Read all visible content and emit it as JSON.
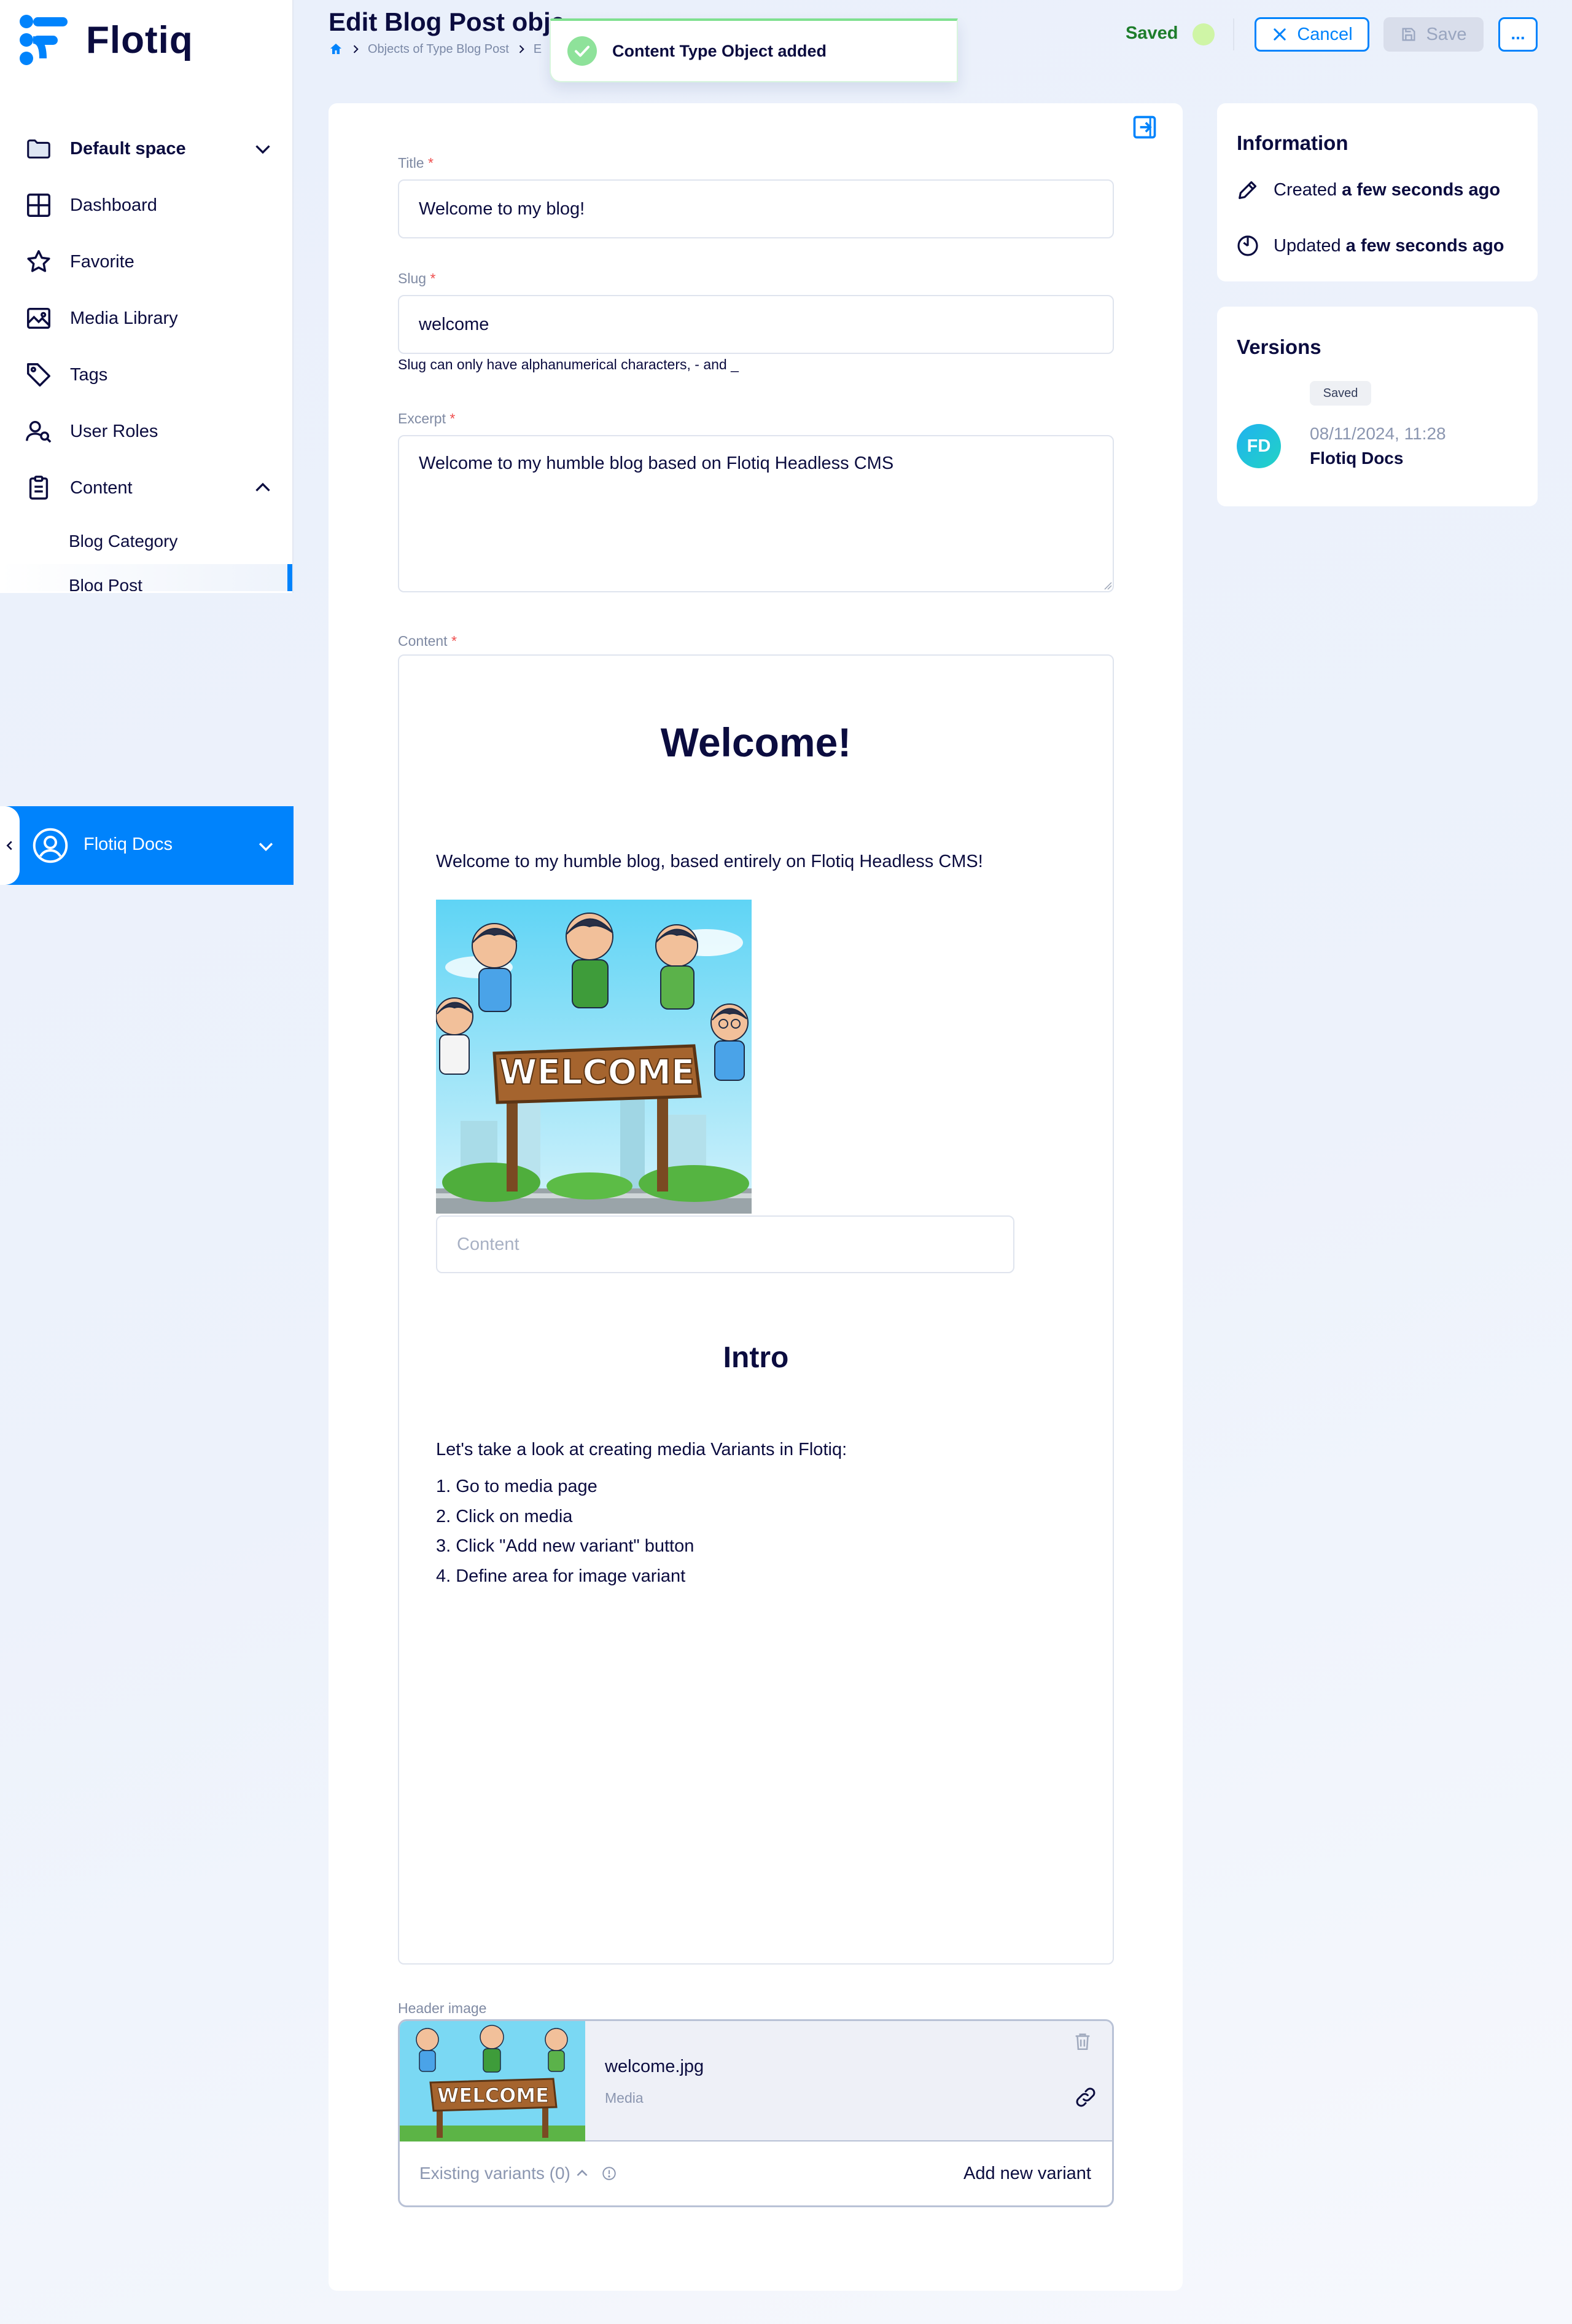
{
  "brand": {
    "name": "Flotiq",
    "accent": "#0083fc",
    "text": "#0b0c3f"
  },
  "sidebar": {
    "space": {
      "label": "Default space",
      "icon": "folder-icon"
    },
    "items": [
      {
        "label": "Dashboard",
        "icon": "grid-icon"
      },
      {
        "label": "Favorite",
        "icon": "star-icon"
      },
      {
        "label": "Media Library",
        "icon": "image-icon"
      },
      {
        "label": "Tags",
        "icon": "tag-icon"
      },
      {
        "label": "User Roles",
        "icon": "user-roles-icon"
      },
      {
        "label": "Content",
        "icon": "clipboard-icon"
      }
    ],
    "content_children": [
      "Blog Category",
      "Blog Post"
    ],
    "user": {
      "name": "Flotiq Docs"
    }
  },
  "header": {
    "title": "Edit Blog Post obje",
    "breadcrumbs": [
      "Objects of Type Blog Post",
      "E"
    ],
    "status": "Saved",
    "cancel_label": "Cancel",
    "save_label": "Save",
    "more_label": "..."
  },
  "toast": {
    "message": "Content Type Object added",
    "status_color": "#7fe08f"
  },
  "form": {
    "title": {
      "label": "Title",
      "value": "Welcome to my blog!"
    },
    "slug": {
      "label": "Slug",
      "value": "welcome",
      "hint": "Slug can only have alphanumerical characters, - and _"
    },
    "excerpt": {
      "label": "Excerpt",
      "value": "Welcome to my humble blog based on Flotiq Headless CMS"
    },
    "content": {
      "label": "Content",
      "heading": "Welcome!",
      "intro_paragraph": "Welcome to my humble blog, based entirely on Flotiq Headless CMS!",
      "image_caption_placeholder": "Content",
      "subheading": "Intro",
      "paragraph": "Let's take a look at creating media Variants in Flotiq:",
      "list": [
        "1. Go to media page",
        "2. Click on media",
        "3. Click \"Add new variant\" button",
        "4. Define area for image variant"
      ],
      "image_sign_text": "WELCOME"
    },
    "header_image": {
      "label": "Header image",
      "file_name": "welcome.jpg",
      "file_type": "Media",
      "variants_label": "Existing variants (0)",
      "add_variant_label": "Add new variant"
    },
    "required_mark": "*"
  },
  "information": {
    "title": "Information",
    "created_prefix": "Created",
    "created_value": "a few seconds ago",
    "updated_prefix": "Updated",
    "updated_value": "a few seconds ago"
  },
  "versions": {
    "title": "Versions",
    "badge": "Saved",
    "avatar_initials": "FD",
    "date": "08/11/2024, 11:28",
    "author": "Flotiq Docs"
  }
}
